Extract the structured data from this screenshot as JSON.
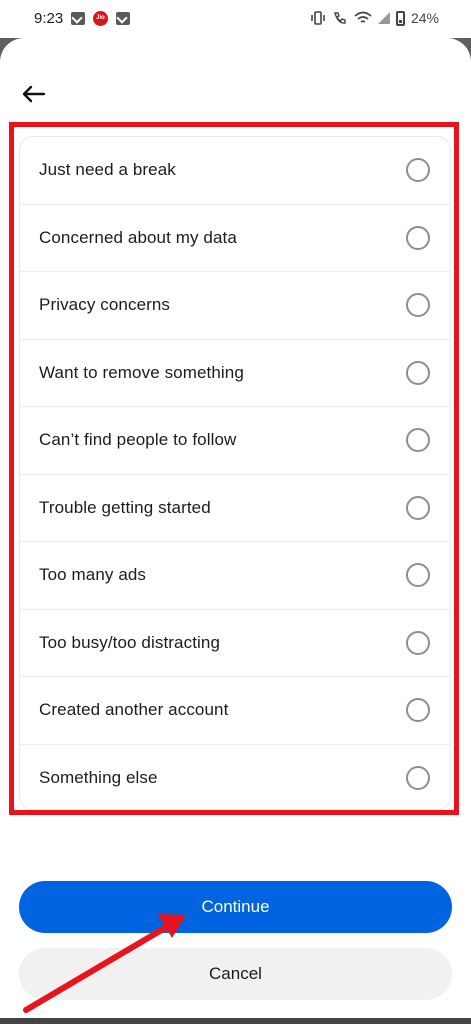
{
  "status_bar": {
    "time": "9:23",
    "battery": "24%"
  },
  "options": [
    {
      "label": "Just need a break"
    },
    {
      "label": "Concerned about my data"
    },
    {
      "label": "Privacy concerns"
    },
    {
      "label": "Want to remove something"
    },
    {
      "label": "Can’t find people to follow"
    },
    {
      "label": "Trouble getting started"
    },
    {
      "label": "Too many ads"
    },
    {
      "label": "Too busy/too distracting"
    },
    {
      "label": "Created another account"
    },
    {
      "label": "Something else"
    }
  ],
  "buttons": {
    "continue_label": "Continue",
    "cancel_label": "Cancel"
  },
  "colors": {
    "primary": "#0064e0",
    "annotation": "#e8131b"
  }
}
